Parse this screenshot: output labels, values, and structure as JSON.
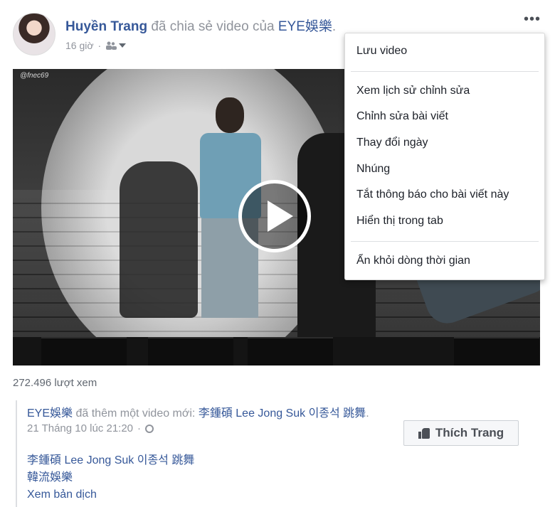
{
  "post": {
    "author": "Huyền Trang",
    "action_text": "đã chia sẻ video của",
    "shared_page": "EYE娛樂",
    "end_dot": ".",
    "time": "16 giờ",
    "separator": "·",
    "views": "272.496 lượt xem",
    "video_watermark": "@fnec69"
  },
  "shared": {
    "page_name": "EYE娛樂",
    "action_text": "đã thêm một video mới:",
    "video_title": "李鍾碩 Lee Jong Suk 이종석 跳舞",
    "end_dot": ".",
    "date": "21 Tháng 10 lúc 21:20",
    "separator": "·",
    "like_button": "Thích Trang",
    "description_lines": [
      "李鍾碩 Lee Jong Suk 이종석 跳舞",
      "韓流娛樂"
    ],
    "see_translation": "Xem bản dịch"
  },
  "menu": {
    "items": [
      "Lưu video",
      "Xem lịch sử chỉnh sửa",
      "Chỉnh sửa bài viết",
      "Thay đổi ngày",
      "Nhúng",
      "Tắt thông báo cho bài viết này",
      "Hiển thị trong tab",
      "Ẩn khỏi dòng thời gian"
    ]
  },
  "icons": {
    "more": "more-options-icon",
    "audience": "friends-icon",
    "public": "globe-icon",
    "like": "thumbs-up-icon",
    "play": "play-icon"
  },
  "colors": {
    "link": "#365899",
    "muted": "#90949c",
    "text": "#1d2129"
  }
}
